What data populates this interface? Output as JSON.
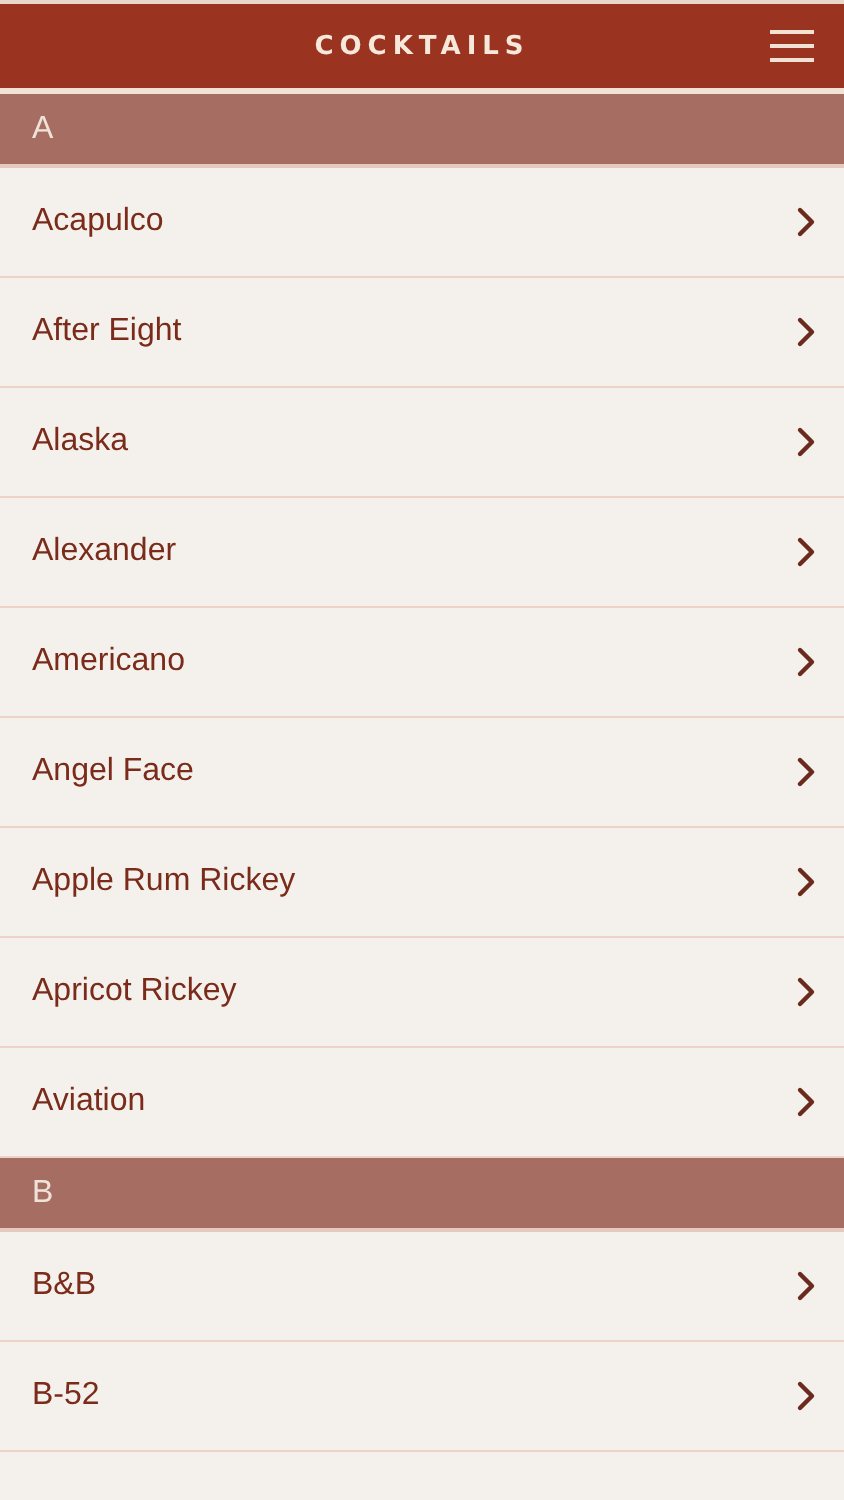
{
  "header": {
    "title": "COCKTAILS"
  },
  "sections": [
    {
      "letter": "A",
      "items": [
        "Acapulco",
        "After Eight",
        "Alaska",
        "Alexander",
        "Americano",
        "Angel Face",
        "Apple Rum Rickey",
        "Apricot Rickey",
        "Aviation"
      ]
    },
    {
      "letter": "B",
      "items": [
        "B&B",
        "B-52"
      ]
    }
  ]
}
